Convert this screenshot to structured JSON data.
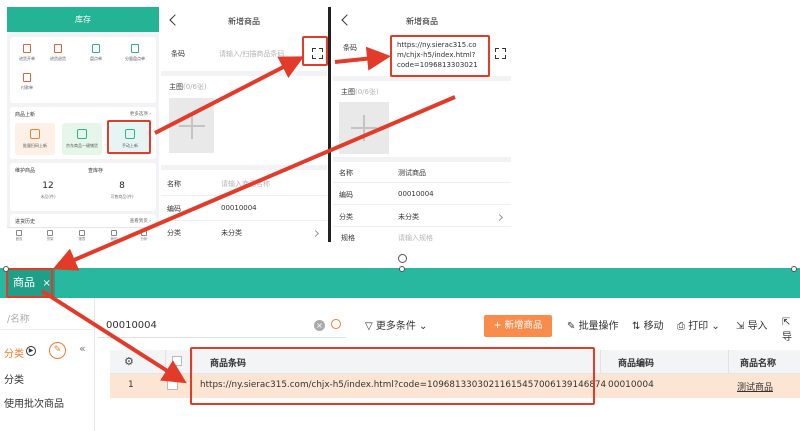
{
  "mobile_home": {
    "title": "库存",
    "quick_items": [
      "进货开单",
      "进货退货",
      "盘点单",
      "分量盘点单",
      "付款单"
    ],
    "product_section": {
      "label": "商品上新",
      "more": "更多选项 ›"
    },
    "tiles": [
      "批量扫码上新",
      "京东商品一键铺货",
      "手动上新"
    ],
    "maint": {
      "label": "维护商品",
      "count": "12",
      "count_caption": "未品(件)"
    },
    "stock": {
      "label": "查库存",
      "count": "8",
      "count_caption": "可售商品(件)"
    },
    "history": {
      "label": "进货历史",
      "more": "查看到货 ›"
    },
    "tabbar": [
      "首页",
      "货架",
      "报表",
      "我的",
      "分析"
    ]
  },
  "form_a": {
    "title": "新增商品",
    "barcode_label": "条码",
    "barcode_placeholder": "请输入/扫描商品条码",
    "main_image_label": "主图",
    "main_image_count": "(0/6张)",
    "name_label": "名称",
    "name_placeholder": "请输入商品名称",
    "code_label": "编码",
    "code_value": "00010004",
    "category_label": "分类",
    "category_value": "未分类"
  },
  "form_b": {
    "title": "新增商品",
    "barcode_label": "条码",
    "barcode_value_line1": "https://ny.sierac315.co",
    "barcode_value_line2": "m/chjx-h5/index.html?",
    "barcode_value_line3": "code=1096813303021",
    "main_image_label": "主图",
    "main_image_count": "(0/6张)",
    "name_label": "名称",
    "name_value": "测试商品",
    "code_label": "编码",
    "code_value": "00010004",
    "category_label": "分类",
    "category_value": "未分类",
    "spec_label": "规格",
    "spec_placeholder": "请输入规格"
  },
  "desktop": {
    "tab_label": "商品",
    "tab_close": "×",
    "left_search_placeholder": "/名称",
    "category_header": "分类",
    "category_items": [
      "分类",
      "使用批次商品"
    ],
    "search_value": "00010004",
    "toolbar": {
      "more_conditions": "更多条件",
      "add_product": "+ 新增商品",
      "batch_ops": "批量操作",
      "move": "移动",
      "print": "打印",
      "import": "导入",
      "export": "导"
    },
    "columns": [
      "商品条码",
      "商品编码",
      "商品名称"
    ],
    "rows": [
      {
        "index": "1",
        "barcode": "https://ny.sierac315.com/chjx-h5/index.html?code=10968133030211615457006139146874",
        "code": "00010004",
        "name": "测试商品"
      }
    ]
  }
}
